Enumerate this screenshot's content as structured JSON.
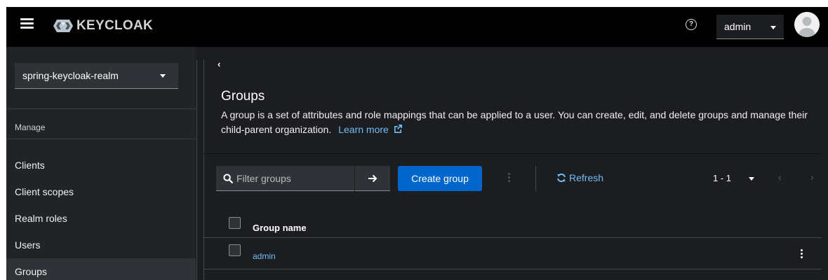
{
  "header": {
    "logo_text": "KEYCLOAK",
    "user_label": "admin",
    "help_glyph": "?"
  },
  "sidebar": {
    "realm_selected": "spring-keycloak-realm",
    "section_title": "Manage",
    "items": [
      {
        "label": "Clients"
      },
      {
        "label": "Client scopes"
      },
      {
        "label": "Realm roles"
      },
      {
        "label": "Users"
      },
      {
        "label": "Groups",
        "active": true
      }
    ]
  },
  "main": {
    "title": "Groups",
    "description": "A group is a set of attributes and role mappings that can be applied to a user. You can create, edit, and delete groups and manage their child-parent organization.",
    "learn_more": "Learn more",
    "toolbar": {
      "filter_placeholder": "Filter groups",
      "create_label": "Create group",
      "refresh_label": "Refresh",
      "pagination": "1 - 1"
    },
    "table": {
      "columns": [
        "Group name"
      ],
      "rows": [
        {
          "name": "admin"
        }
      ]
    }
  },
  "colors": {
    "accent": "#0066cc",
    "link": "#73bcf7",
    "header_bg": "#000000",
    "sidebar_bg": "#212427",
    "content_bg": "#1b1d21"
  }
}
